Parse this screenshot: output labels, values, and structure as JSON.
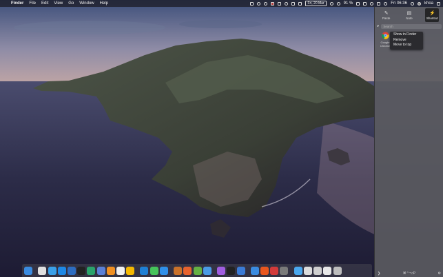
{
  "menubar": {
    "apple_glyph": "",
    "app_name": "Finder",
    "menus": [
      "File",
      "Edit",
      "View",
      "Go",
      "Window",
      "Help"
    ],
    "date_badge": "Fri, 20 Mar",
    "battery": "91 %",
    "clock": "Fri 06:36",
    "user": "khoa"
  },
  "panel": {
    "tabs": [
      {
        "label": "Paste",
        "icon": "paste-icon"
      },
      {
        "label": "Note",
        "icon": "note-icon"
      },
      {
        "label": "Shortcut",
        "icon": "shortcut-icon"
      }
    ],
    "active_tab": "Shortcut",
    "search_placeholder": "Search",
    "item": {
      "label": "Google Chrome",
      "icon": "chrome-icon"
    },
    "context_menu": [
      "Show in Finder",
      "Remove",
      "Move to top"
    ],
    "footer_left": "❯",
    "footer_shortcut": "⌘⌃⌥P"
  },
  "dock": {
    "apps": [
      {
        "name": "finder-app",
        "color": "#3a8be0"
      },
      {
        "name": "chrome-app",
        "color": "#e0e0e0"
      },
      {
        "name": "folder-blue-app",
        "color": "#3aa0e8"
      },
      {
        "name": "app-store-app",
        "color": "#1e88e5"
      },
      {
        "name": "xcode-app",
        "color": "#2d6cc0"
      },
      {
        "name": "terminal-app",
        "color": "#222222"
      },
      {
        "name": "notes-app",
        "color": "#2aa36b"
      },
      {
        "name": "preview-app",
        "color": "#5a7fd6"
      },
      {
        "name": "sublime-app",
        "color": "#ef8f22"
      },
      {
        "name": "photos-app",
        "color": "#f0f0f0"
      },
      {
        "name": "sketch-app",
        "color": "#f5b800"
      },
      {
        "name": "vscode-app",
        "color": "#1e7fd4"
      },
      {
        "name": "wechat-app",
        "color": "#45c35a"
      },
      {
        "name": "safari-app",
        "color": "#2f8fe8"
      },
      {
        "name": "automator-app",
        "color": "#c9712a"
      },
      {
        "name": "firefox-app",
        "color": "#e6622e"
      },
      {
        "name": "alien-app",
        "color": "#65b043"
      },
      {
        "name": "files-app",
        "color": "#4a9be6"
      },
      {
        "name": "podcasts-app",
        "color": "#a05de0"
      },
      {
        "name": "appletv-app",
        "color": "#222222"
      },
      {
        "name": "onepassword-app",
        "color": "#3b7bd6"
      },
      {
        "name": "finder-folder-app",
        "color": "#3a8be0"
      },
      {
        "name": "brave-app",
        "color": "#e8561f"
      },
      {
        "name": "mail-app",
        "color": "#d23a3a"
      },
      {
        "name": "grid-app",
        "color": "#7a7a7a"
      },
      {
        "name": "folder-app",
        "color": "#4aa8ef"
      },
      {
        "name": "window-app",
        "color": "#dcdcdc"
      },
      {
        "name": "window2-app",
        "color": "#cfcfcf"
      },
      {
        "name": "window3-app",
        "color": "#e8e8e8"
      },
      {
        "name": "trash-app",
        "color": "#bdbdbd"
      }
    ]
  }
}
